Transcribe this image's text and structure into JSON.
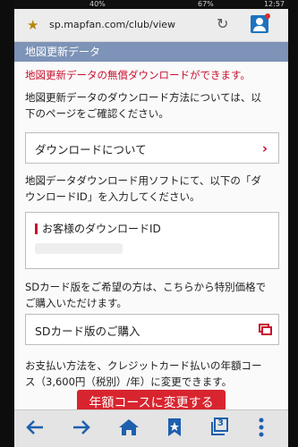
{
  "status": {
    "battery_left": "40%",
    "battery_right": "67%",
    "time": "12:57"
  },
  "browser": {
    "url": "sp.mapfan.com/club/view"
  },
  "section": {
    "title": "地図更新データ"
  },
  "notice": "地図更新データの無償ダウンロードができます。",
  "desc1_l1": "地図更新データのダウンロード方法については、以",
  "desc1_l2": "下のページをご確認ください。",
  "about_download": "ダウンロードについて",
  "desc2_l1": "地図データダウンロード用ソフトにて、以下の「ダ",
  "desc2_l2": "ウンロードID」を入力してください。",
  "id_label": "お客様のダウンロードID",
  "desc3_l1": "SDカード版をご希望の方は、こちらから特別価格で",
  "desc3_l2": "ご購入いただけます。",
  "sd_purchase": "SDカード版のご購入",
  "desc4_l1": "お支払い方法を、クレジットカード払いの年額コー",
  "desc4_l2": "ス（3,600円（税別）/年）に変更できます。",
  "cta": "年額コースに変更する",
  "icons": {
    "star": "star-icon",
    "reload": "reload-icon",
    "account": "account-icon",
    "back": "arrow-left-icon",
    "forward": "arrow-right-icon",
    "home": "home-icon",
    "bookmarks": "bookmark-icon",
    "tabs": "tabs-icon",
    "menu": "more-vertical-icon"
  },
  "nav": {
    "tabs_count": "3"
  },
  "colors": {
    "header": "#7d93b7",
    "accent": "#c8102e",
    "cta": "#d8242e",
    "nav": "#1e5fae"
  }
}
